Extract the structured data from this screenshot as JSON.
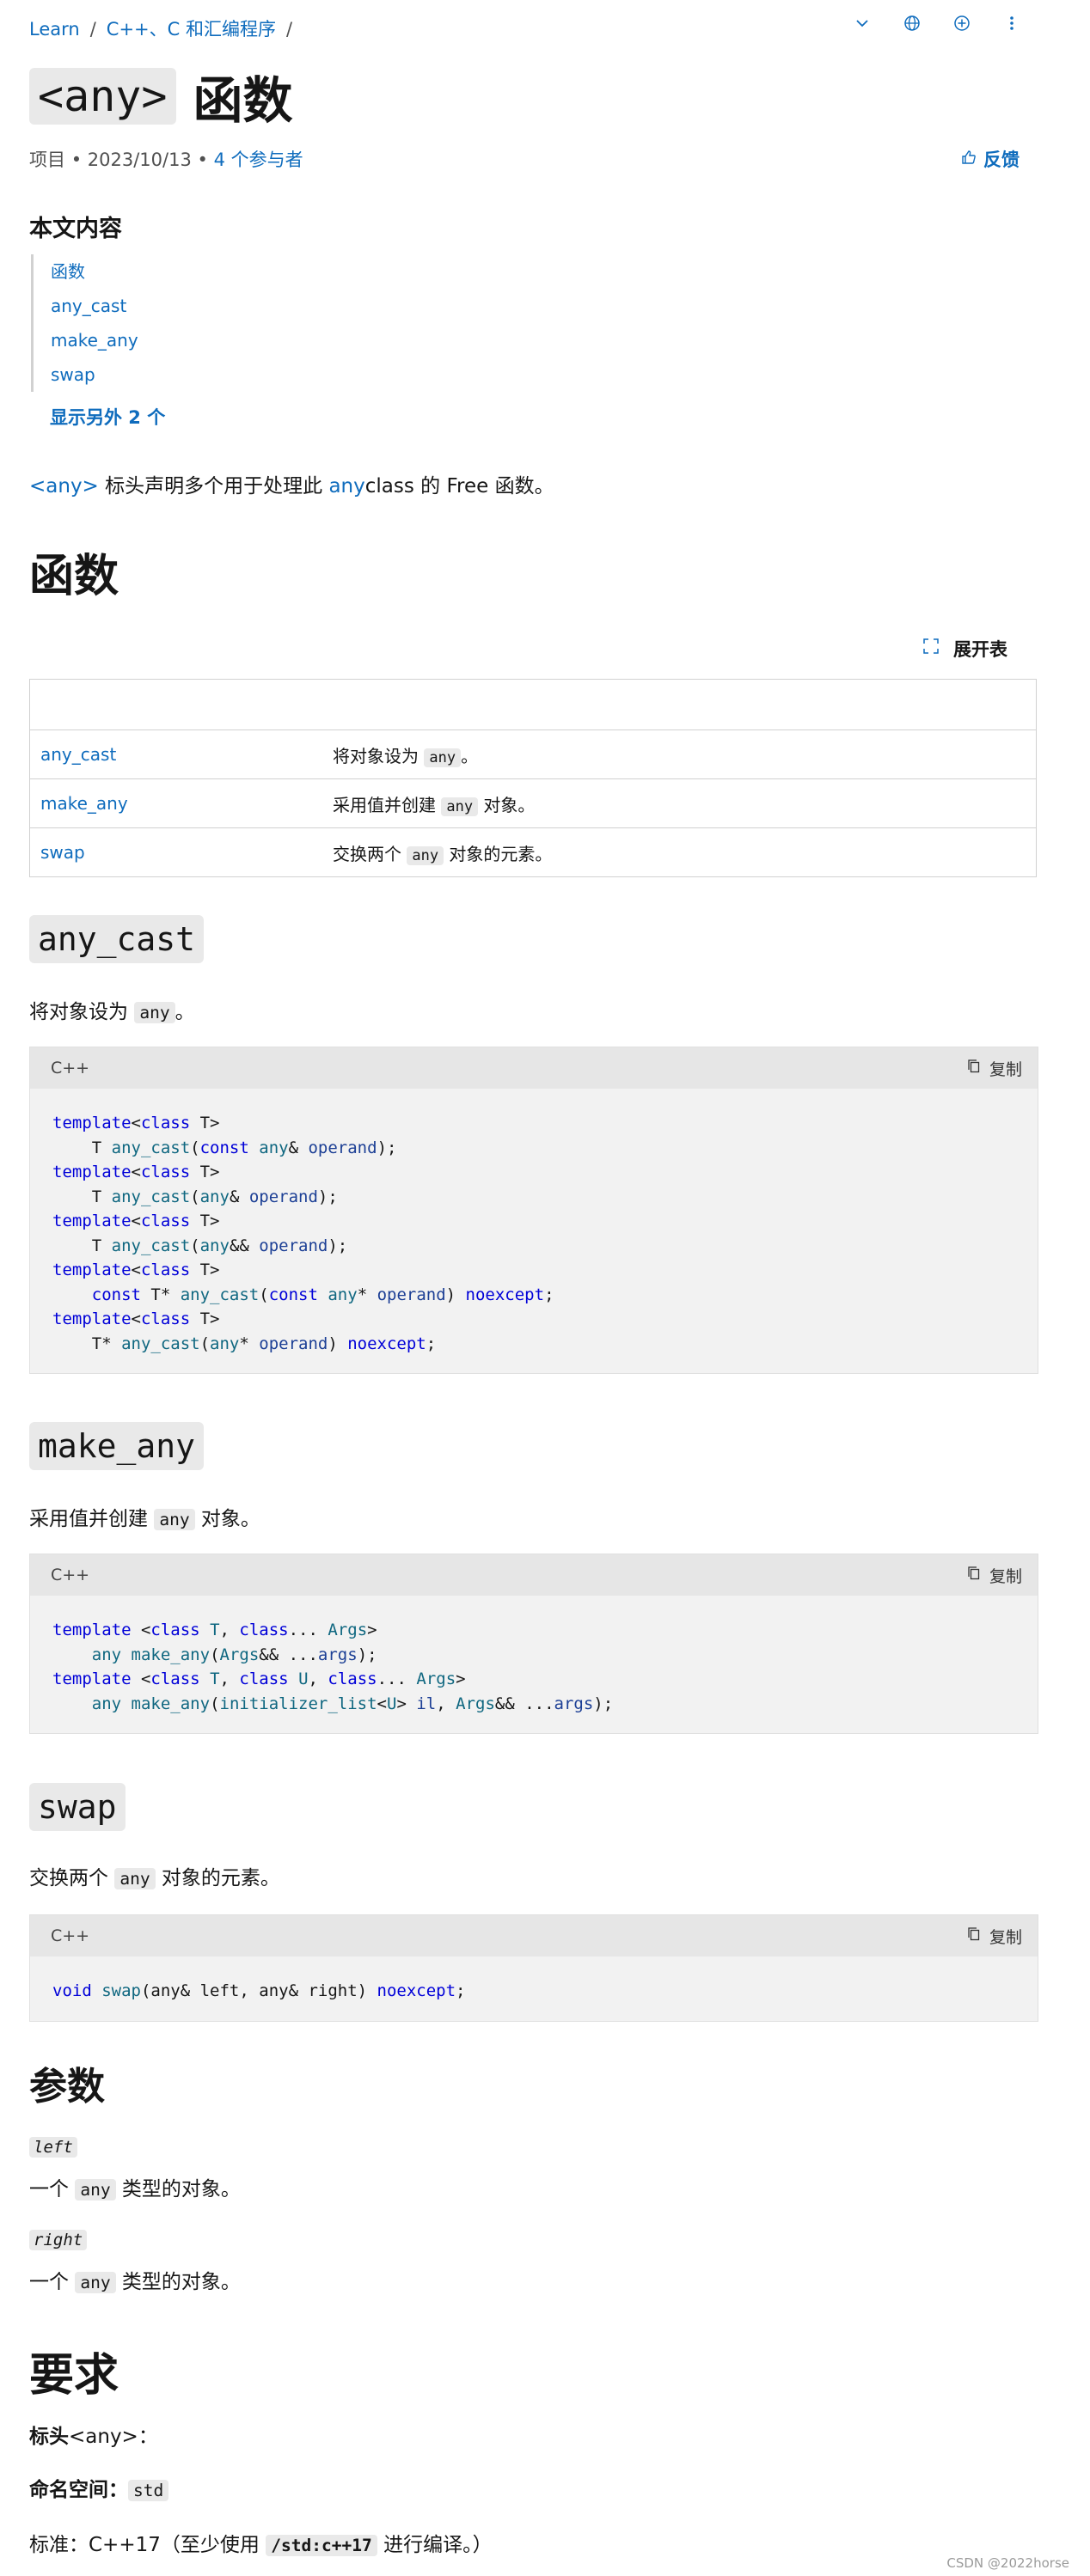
{
  "breadcrumb": {
    "items": [
      "Learn",
      "C++、C 和汇编程序"
    ],
    "sep": "/"
  },
  "icons": {
    "chevron": "chevron-down-icon",
    "globe": "globe-icon",
    "add": "add-circle-icon",
    "more": "more-vertical-icon"
  },
  "title": {
    "code": "<any>",
    "text": "函数"
  },
  "meta": {
    "kind": "项目",
    "date": "2023/10/13",
    "dot": "•",
    "contributors": "4 个参与者"
  },
  "feedback": {
    "label": "反馈",
    "icon": "thumbs-up-icon"
  },
  "toc": {
    "title": "本文内容",
    "items": [
      "函数",
      "any_cast",
      "make_any",
      "swap"
    ],
    "more": "显示另外 2 个"
  },
  "intro": {
    "link": "<any>",
    "text1": " 标头声明多个用于处理此 ",
    "link2": "any",
    "text2": "class 的 Free 函数。"
  },
  "section_functions": {
    "title": "函数",
    "expand_label": "展开表",
    "rows": [
      {
        "name": "any_cast",
        "pre": "将对象设为 ",
        "code": "any",
        "post": "。"
      },
      {
        "name": "make_any",
        "pre": "采用值并创建 ",
        "code": "any",
        "post": " 对象。"
      },
      {
        "name": "swap",
        "pre": "交换两个 ",
        "code": "any",
        "post": " 对象的元素。"
      }
    ]
  },
  "code_lang": "C++",
  "copy_label": "复制",
  "any_cast": {
    "title": "any_cast",
    "desc_pre": "将对象设为 ",
    "desc_code": "any",
    "desc_post": "。"
  },
  "make_any": {
    "title": "make_any",
    "desc_pre": "采用值并创建 ",
    "desc_code": "any",
    "desc_post": " 对象。"
  },
  "swap": {
    "title": "swap",
    "desc_pre": "交换两个 ",
    "desc_code": "any",
    "desc_post": " 对象的元素。"
  },
  "params": {
    "title": "参数",
    "items": [
      {
        "name": "left",
        "pre": "一个 ",
        "code": "any",
        "post": " 类型的对象。"
      },
      {
        "name": "right",
        "pre": "一个 ",
        "code": "any",
        "post": " 类型的对象。"
      }
    ]
  },
  "requirements": {
    "title": "要求",
    "header_label": "标头",
    "header_value": "<any>：",
    "ns_label": "命名空间：",
    "ns_value": "std",
    "std_pre": "标准：C++17（至少使用 ",
    "std_code": "/std:c++17",
    "std_post": " 进行编译。）"
  },
  "watermark": "CSDN @2022horse"
}
